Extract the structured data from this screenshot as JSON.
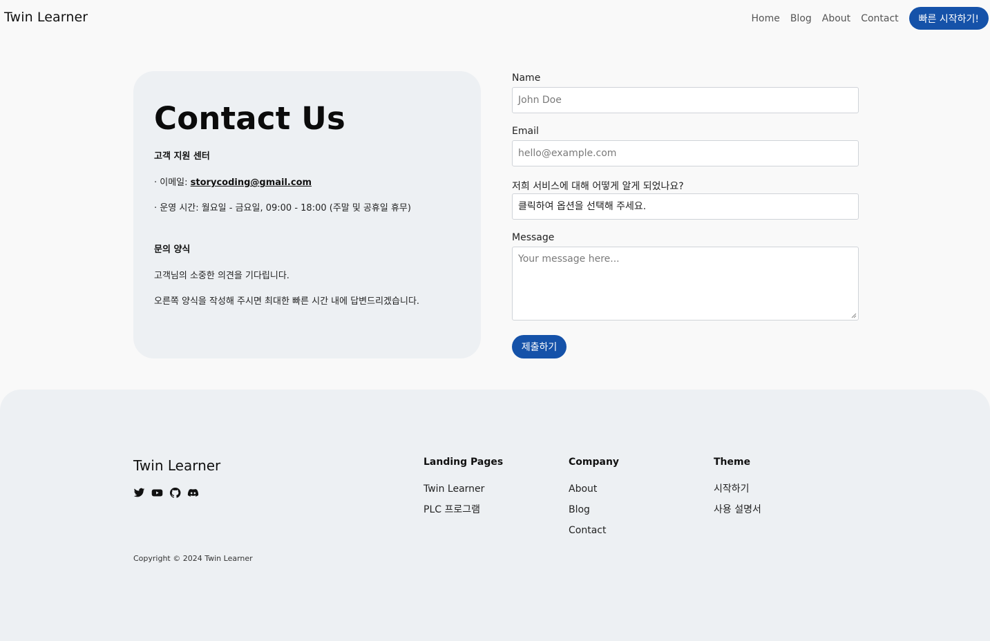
{
  "header": {
    "brand": "Twin Learner",
    "nav": [
      "Home",
      "Blog",
      "About",
      "Contact"
    ],
    "cta_label": "빠른 시작하기!"
  },
  "info": {
    "title": "Contact Us",
    "support_heading": "고객 지원 센터",
    "email_prefix": "· 이메일: ",
    "email": "storycoding@gmail.com",
    "hours": "· 운영 시간: 월요일 - 금요일, 09:00 - 18:00 (주말 및 공휴일 휴무)",
    "form_heading": "문의 양식",
    "line1": "고객님의 소중한 의견을 기다립니다.",
    "line2": "오른쪽 양식을 작성해 주시면 최대한 빠른 시간 내에 답변드리겠습니다."
  },
  "form": {
    "name_label": "Name",
    "name_placeholder": "John Doe",
    "email_label": "Email",
    "email_placeholder": "hello@example.com",
    "source_label": "저희 서비스에 대해 어떻게 알게 되었나요?",
    "source_value": "클릭하여 옵션을 선택해 주세요.",
    "message_label": "Message",
    "message_placeholder": "Your message here...",
    "submit_label": "제출하기"
  },
  "footer": {
    "brand": "Twin Learner",
    "socials": [
      "twitter-icon",
      "youtube-icon",
      "github-icon",
      "discord-icon"
    ],
    "columns": [
      {
        "title": "Landing Pages",
        "links": [
          "Twin Learner",
          "PLC 프로그램"
        ]
      },
      {
        "title": "Company",
        "links": [
          "About",
          "Blog",
          "Contact"
        ]
      },
      {
        "title": "Theme",
        "links": [
          "시작하기",
          "사용 설명서"
        ]
      }
    ],
    "copyright": "Copyright © 2024 Twin Learner"
  },
  "colors": {
    "accent": "#1552a9",
    "page_bg": "#f9f9f9",
    "panel_bg": "#edf0f3"
  }
}
